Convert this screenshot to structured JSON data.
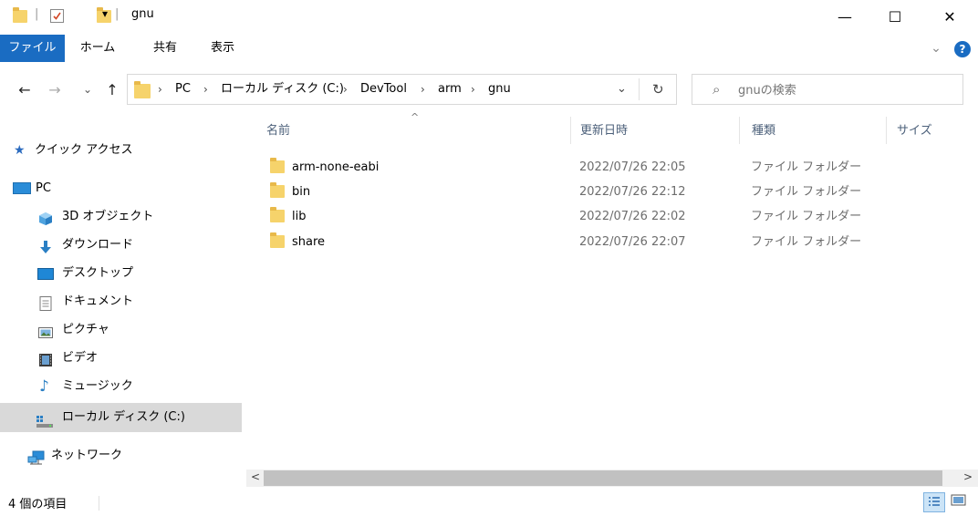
{
  "titlebar": {
    "title": "gnu",
    "buttons": {
      "minimize": "—",
      "maximize": "☐",
      "close": "✕"
    },
    "qa_separator": "|",
    "qa_dropdown": "▾"
  },
  "ribbon": {
    "tabs": [
      "ファイル",
      "ホーム",
      "共有",
      "表示"
    ],
    "collapse_icon": "⌄",
    "help": "?",
    "accent": "#1a6cc2"
  },
  "nav": {
    "back": "←",
    "forward": "→",
    "recent": "⌄",
    "up": "↑",
    "refresh": "↻",
    "dropdown": "⌄"
  },
  "address": {
    "crumbs": [
      "PC",
      "ローカル ディスク (C:)",
      "DevTool",
      "arm",
      "gnu"
    ],
    "separator": "›"
  },
  "search": {
    "placeholder": "gnuの検索",
    "icon": "⌕"
  },
  "sidebar": {
    "items": [
      {
        "label": "クイック アクセス",
        "icon": "star-icon"
      },
      {
        "label": "PC",
        "icon": "computer-icon"
      },
      {
        "label": "3D オブジェクト",
        "icon": "cube-icon"
      },
      {
        "label": "ダウンロード",
        "icon": "download-icon"
      },
      {
        "label": "デスクトップ",
        "icon": "desktop-icon"
      },
      {
        "label": "ドキュメント",
        "icon": "document-icon"
      },
      {
        "label": "ピクチャ",
        "icon": "picture-icon"
      },
      {
        "label": "ビデオ",
        "icon": "video-icon"
      },
      {
        "label": "ミュージック",
        "icon": "music-icon"
      },
      {
        "label": "ローカル ディスク (C:)",
        "icon": "drive-icon",
        "selected": true
      },
      {
        "label": "ネットワーク",
        "icon": "network-icon"
      }
    ]
  },
  "table": {
    "columns": [
      "名前",
      "更新日時",
      "種類",
      "サイズ"
    ],
    "sort_indicator": "^",
    "rows": [
      {
        "name": "arm-none-eabi",
        "date": "2022/07/26 22:05",
        "type": "ファイル フォルダー"
      },
      {
        "name": "bin",
        "date": "2022/07/26 22:12",
        "type": "ファイル フォルダー"
      },
      {
        "name": "lib",
        "date": "2022/07/26 22:02",
        "type": "ファイル フォルダー"
      },
      {
        "name": "share",
        "date": "2022/07/26 22:07",
        "type": "ファイル フォルダー"
      }
    ]
  },
  "scrollbar": {
    "left": "<",
    "right": ">"
  },
  "status": {
    "count": "4 個の項目"
  }
}
